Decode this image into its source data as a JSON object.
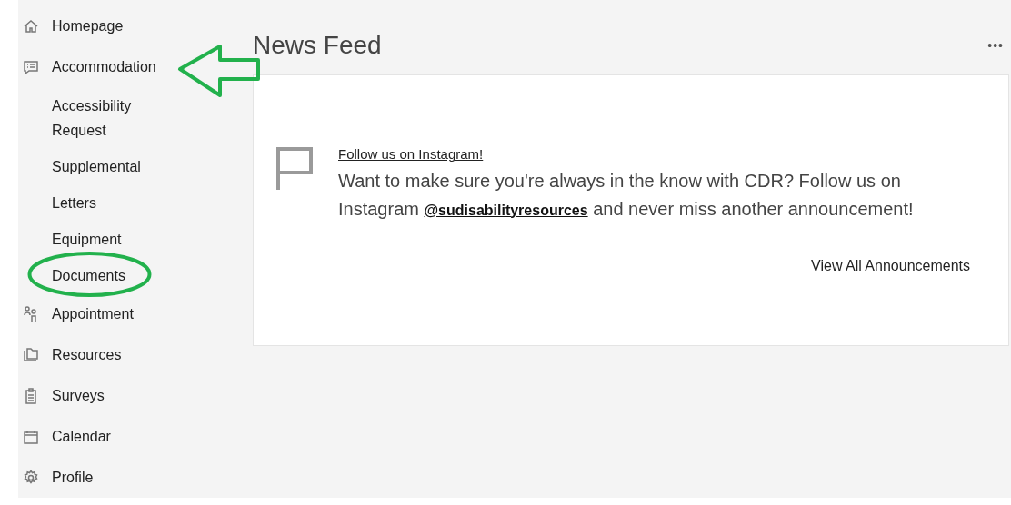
{
  "sidebar": {
    "items": [
      {
        "label": "Homepage"
      },
      {
        "label": "Accommodation",
        "children": [
          {
            "label": "Accessibility Request"
          },
          {
            "label": "Supplemental"
          },
          {
            "label": "Letters"
          },
          {
            "label": "Equipment"
          },
          {
            "label": "Documents"
          }
        ]
      },
      {
        "label": "Appointment"
      },
      {
        "label": "Resources"
      },
      {
        "label": "Surveys"
      },
      {
        "label": "Calendar"
      },
      {
        "label": "Profile"
      }
    ]
  },
  "news_feed": {
    "title": "News Feed",
    "menu": "•••",
    "announcement": {
      "title": "Follow us on Instagram!",
      "text_before": "Want to make sure you're always in the know with CDR? Follow us on Instagram",
      "handle": "@sudisabilityresources",
      "text_after": "and never miss another announcement!"
    },
    "view_all": "View All Announcements"
  }
}
